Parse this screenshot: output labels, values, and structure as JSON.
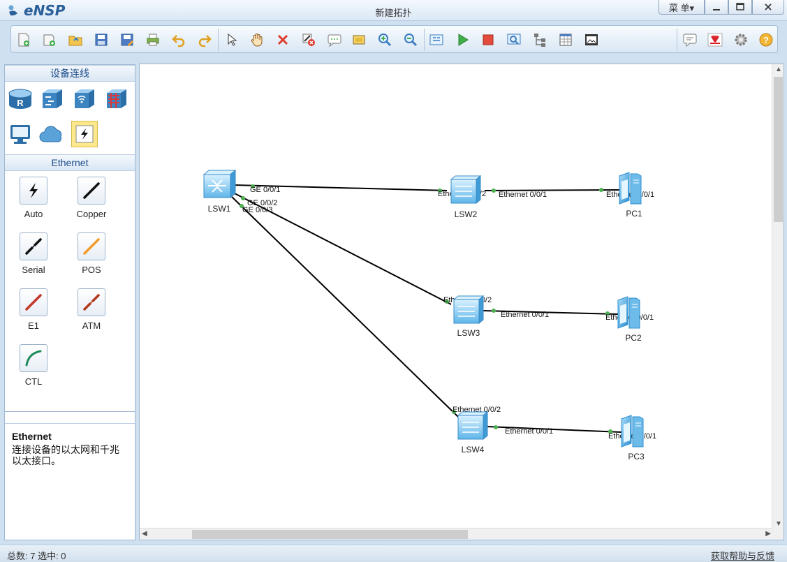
{
  "app": {
    "logo_text": "eNSP",
    "window_title": "新建拓扑",
    "menu_label": "菜 单▾"
  },
  "toolbar": {
    "buttons": [
      "new-topology",
      "new-lab",
      "open",
      "save",
      "save-as",
      "print",
      "undo",
      "redo",
      "select",
      "pan",
      "delete",
      "delete-link",
      "text-note",
      "palette",
      "zoom-in",
      "zoom-out",
      "fit",
      "start-device",
      "stop-device",
      "capture",
      "topology-view",
      "grid",
      "screenshot",
      "chat",
      "huawei",
      "settings",
      "help"
    ]
  },
  "left_panel": {
    "device_section_title": "设备连线",
    "connection_section_title": "Ethernet",
    "connections": [
      {
        "label": "Auto",
        "color": "#111111"
      },
      {
        "label": "Copper",
        "color": "#111111"
      },
      {
        "label": "Serial",
        "color": "#111111"
      },
      {
        "label": "POS",
        "color": "#f29b2a"
      },
      {
        "label": "E1",
        "color": "#c0392b"
      },
      {
        "label": "ATM",
        "color": "#b23a1e"
      },
      {
        "label": "CTL",
        "color": "#1f8a5a"
      }
    ],
    "description_title": "Ethernet",
    "description_text": "连接设备的以太网和千兆以太接口。"
  },
  "topology": {
    "devices": [
      {
        "id": "LSW1",
        "label": "LSW1",
        "type": "core-switch"
      },
      {
        "id": "LSW2",
        "label": "LSW2",
        "type": "switch"
      },
      {
        "id": "LSW3",
        "label": "LSW3",
        "type": "switch"
      },
      {
        "id": "LSW4",
        "label": "LSW4",
        "type": "switch"
      },
      {
        "id": "PC1",
        "label": "PC1",
        "type": "pc"
      },
      {
        "id": "PC2",
        "label": "PC2",
        "type": "pc"
      },
      {
        "id": "PC3",
        "label": "PC3",
        "type": "pc"
      }
    ],
    "links": [
      {
        "from": "LSW1",
        "from_port": "GE 0/0/1",
        "to": "LSW2",
        "to_port": "Ethernet 0/0/2"
      },
      {
        "from": "LSW1",
        "from_port": "GE 0/0/2",
        "to": "LSW3",
        "to_port": "Ethernet 0/0/2"
      },
      {
        "from": "LSW1",
        "from_port": "GE 0/0/3",
        "to": "LSW4",
        "to_port": "Ethernet 0/0/2"
      },
      {
        "from": "LSW2",
        "from_port": "Ethernet 0/0/1",
        "to": "PC1",
        "to_port": "Ethernet 0/0/1"
      },
      {
        "from": "LSW3",
        "from_port": "Ethernet 0/0/1",
        "to": "PC2",
        "to_port": "Ethernet 0/0/1"
      },
      {
        "from": "LSW4",
        "from_port": "Ethernet 0/0/1",
        "to": "PC3",
        "to_port": "Ethernet 0/0/1"
      }
    ]
  },
  "status_bar": {
    "left_text": "总数: 7  选中: 0",
    "right_text": "获取帮助与反馈"
  },
  "colors": {
    "link_up_dot": "#4caf50",
    "device_blue": "#39a7e0"
  }
}
